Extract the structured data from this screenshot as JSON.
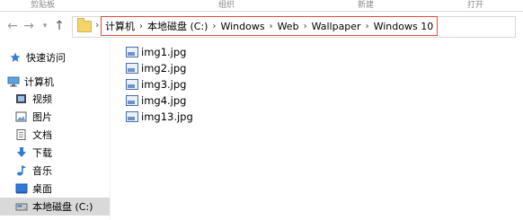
{
  "ribbon": {
    "groups": [
      {
        "label": "剪贴板"
      },
      {
        "label": "组织"
      },
      {
        "label": "新建"
      },
      {
        "label": "打开"
      }
    ]
  },
  "address": {
    "crumbs": [
      "计算机",
      "本地磁盘 (C:)",
      "Windows",
      "Web",
      "Wallpaper",
      "Windows 10"
    ],
    "highlight_color": "#e0483e"
  },
  "nav": {
    "items": [
      {
        "label": "快速访问",
        "icon": "pin-icon"
      },
      {
        "label": "计算机",
        "icon": "computer-icon"
      },
      {
        "label": "视频",
        "icon": "video-icon"
      },
      {
        "label": "图片",
        "icon": "pictures-icon"
      },
      {
        "label": "文档",
        "icon": "documents-icon"
      },
      {
        "label": "下载",
        "icon": "download-icon"
      },
      {
        "label": "音乐",
        "icon": "music-icon"
      },
      {
        "label": "桌面",
        "icon": "desktop-icon"
      },
      {
        "label": "本地磁盘 (C:)",
        "icon": "drive-icon",
        "selected": true
      }
    ]
  },
  "files": [
    {
      "name": "img1.jpg"
    },
    {
      "name": "img2.jpg"
    },
    {
      "name": "img3.jpg"
    },
    {
      "name": "img4.jpg"
    },
    {
      "name": "img13.jpg"
    }
  ]
}
